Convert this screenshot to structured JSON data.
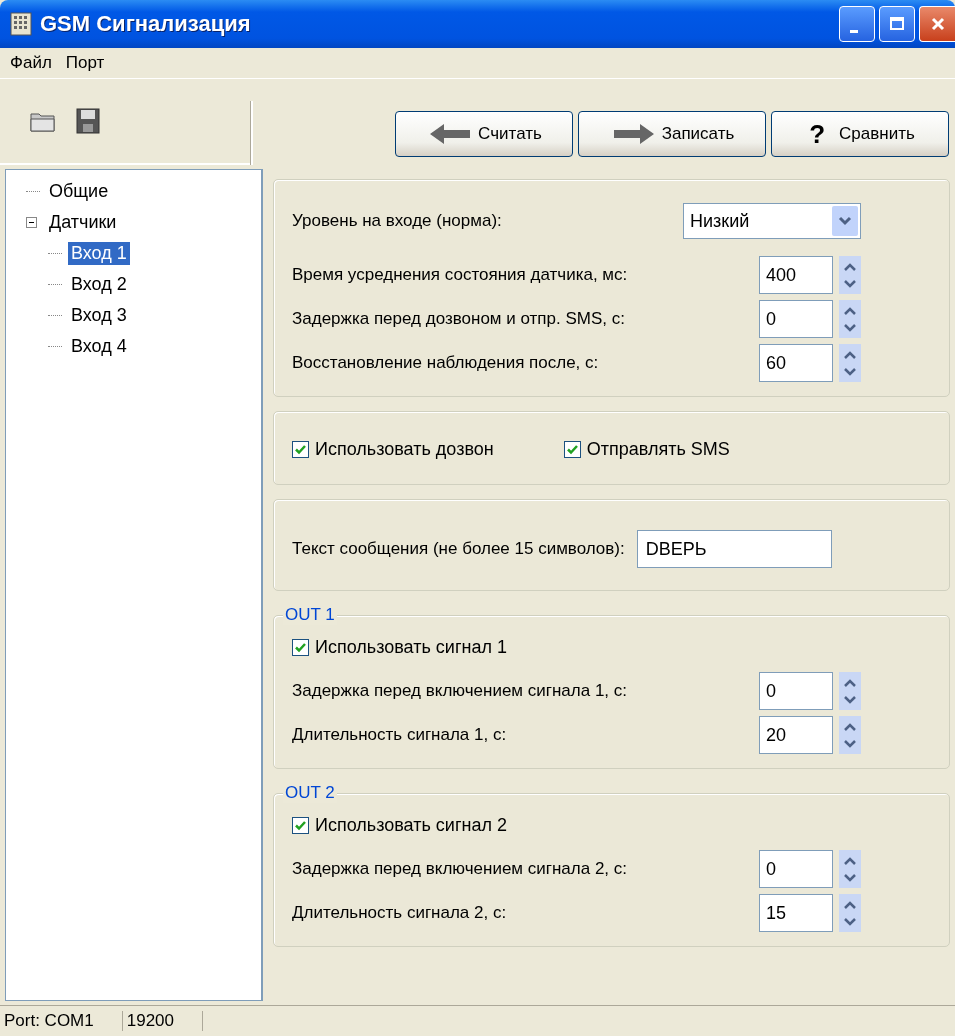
{
  "window": {
    "title": "GSM Сигнализация"
  },
  "menu": [
    {
      "label": "Файл"
    },
    {
      "label": "Порт"
    }
  ],
  "actions": [
    {
      "kind": "arrow-left",
      "label": "Считать"
    },
    {
      "kind": "arrow-right",
      "label": "Записать"
    },
    {
      "kind": "glyph",
      "glyph": "?",
      "label": "Сравнить"
    }
  ],
  "tree": [
    {
      "label": "Общие",
      "selected": false
    },
    {
      "label": "Датчики",
      "selected": false,
      "expanded": true,
      "children": [
        {
          "label": "Вход 1",
          "selected": true
        },
        {
          "label": "Вход 2",
          "selected": false
        },
        {
          "label": "Вход 3",
          "selected": false
        },
        {
          "label": "Вход 4",
          "selected": false
        }
      ]
    }
  ],
  "groups": [
    {
      "kind": "stack",
      "rows": [
        {
          "kind": "dropdown",
          "label": "Уровень на входе (норма):",
          "value": "Низкий"
        },
        {
          "kind": "spin",
          "label": "Время усреднения состояния датчика, мс:",
          "value": "400"
        },
        {
          "kind": "spin",
          "label": "Задержка перед дозвоном и отпр. SMS, с:",
          "value": "0"
        },
        {
          "kind": "spin",
          "label": "Восстановление наблюдения после, с:",
          "value": "60"
        }
      ]
    },
    {
      "kind": "inline",
      "rows": [
        {
          "kind": "checkbox",
          "label": "Использовать дозвон",
          "checked": true
        },
        {
          "kind": "checkbox",
          "label": "Отправлять SMS",
          "checked": true
        }
      ]
    },
    {
      "kind": "stack",
      "rows": [
        {
          "kind": "text",
          "label": "Текст сообщения (не более 15 символов):",
          "value": "DВЕРЬ"
        }
      ]
    },
    {
      "kind": "stack",
      "legend": "OUT 1",
      "rows": [
        {
          "kind": "checkbox",
          "label": "Использовать сигнал 1",
          "checked": true
        },
        {
          "kind": "spin",
          "label": "Задержка перед включением сигнала 1, с:",
          "value": "0"
        },
        {
          "kind": "spin",
          "label": "Длительность сигнала 1, с:",
          "value": "20"
        }
      ]
    },
    {
      "kind": "stack",
      "legend": "OUT 2",
      "rows": [
        {
          "kind": "checkbox",
          "label": "Использовать сигнал 2",
          "checked": true
        },
        {
          "kind": "spin",
          "label": "Задержка перед включением сигнала 2, с:",
          "value": "0"
        },
        {
          "kind": "spin",
          "label": "Длительность сигнала 2, с:",
          "value": "15"
        }
      ]
    }
  ],
  "status_bar": [
    {
      "text": "Port: COM1"
    },
    {
      "text": "19200"
    }
  ]
}
